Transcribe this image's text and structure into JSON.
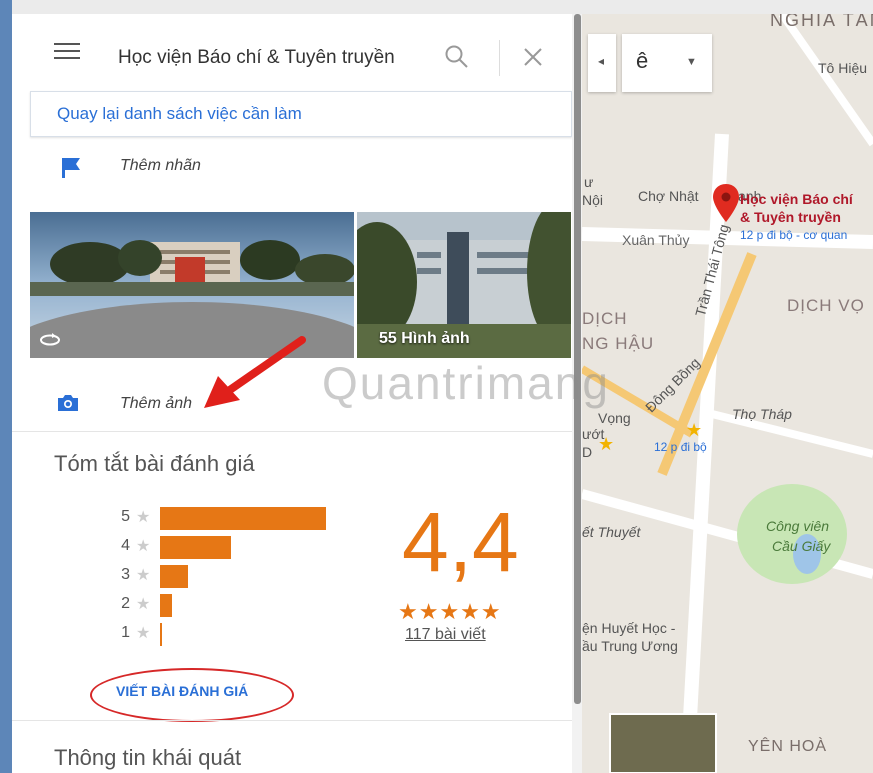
{
  "search": {
    "query": "Học viện Báo chí & Tuyên truyền"
  },
  "back_link": "Quay lại danh sách việc cần làm",
  "add_label": "Thêm nhãn",
  "photos": {
    "count_label": "55 Hình ảnh"
  },
  "add_photo": "Thêm ảnh",
  "review_summary": {
    "title": "Tóm tắt bài đánh giá",
    "rating": "4,4",
    "stars": "★★★★★",
    "review_count": "117 bài viết",
    "write_review": "VIẾT BÀI ĐÁNH GIÁ",
    "distribution": [
      {
        "stars": "5",
        "fraction": 1.0
      },
      {
        "stars": "4",
        "fraction": 0.43
      },
      {
        "stars": "3",
        "fraction": 0.17
      },
      {
        "stars": "2",
        "fraction": 0.07
      },
      {
        "stars": "1",
        "fraction": 0.01
      }
    ]
  },
  "overview_title": "Thông tin khái quát",
  "watermark": "Quantrimang",
  "map": {
    "top_input": "ê",
    "labels": {
      "nghia_tan": "NGHĨA TÂN",
      "to_hieu": "Tô Hiệu",
      "su": "ư",
      "noi": "Nội",
      "cho_nhat": "Chợ Nhật",
      "anh": "anh",
      "xuan_thuy": "Xuân Thủy",
      "dich": "DỊCH",
      "ng_hau": "NG HẬU",
      "dich_vong": "DỊCH VỌ",
      "tran_thai_tong": "Trần Thái Tông",
      "dong_bong": "Đông Bồng",
      "vong": "Vọng",
      "tho_thap": "Thọ Tháp",
      "uot": "ướt",
      "d": "D",
      "walk2": "12 p đi bộ",
      "thuyet": "ết Thuyết",
      "cong_vien": "Công viên",
      "cau_giay": "Cầu Giấy",
      "huyet_hoc": "ện Huyết Học -",
      "trung_uong": "ầu Trung Ương",
      "yen_hoa": "YÊN HOÀ"
    },
    "poi": {
      "line1": "Học viện Báo chí",
      "line2": "& Tuyên truyền",
      "walk": "12 p đi bộ - cơ quan"
    }
  },
  "colors": {
    "accent": "#e67715",
    "link": "#2a6fd6",
    "poi": "#b0182a"
  }
}
